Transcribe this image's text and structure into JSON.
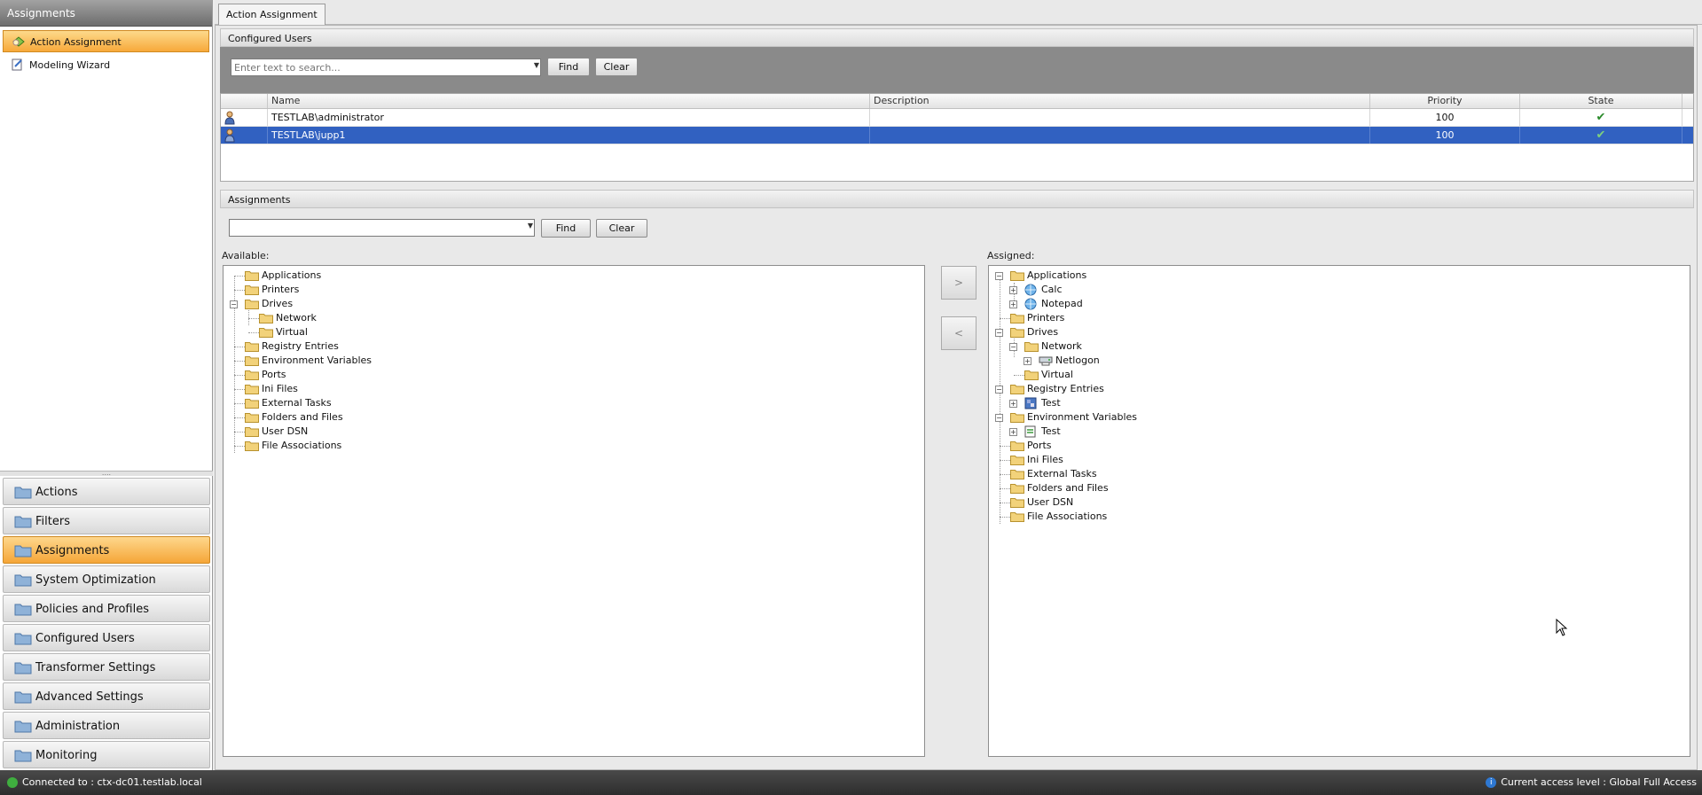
{
  "left_nav": {
    "header": "Assignments",
    "items": [
      {
        "label": "Action Assignment",
        "active": true
      },
      {
        "label": "Modeling Wizard",
        "active": false
      }
    ],
    "splitter_grip": "....",
    "sections": [
      {
        "label": "Actions",
        "active": false
      },
      {
        "label": "Filters",
        "active": false
      },
      {
        "label": "Assignments",
        "active": true
      },
      {
        "label": "System Optimization",
        "active": false
      },
      {
        "label": "Policies and Profiles",
        "active": false
      },
      {
        "label": "Configured Users",
        "active": false
      },
      {
        "label": "Transformer Settings",
        "active": false
      },
      {
        "label": "Advanced Settings",
        "active": false
      },
      {
        "label": "Administration",
        "active": false
      },
      {
        "label": "Monitoring",
        "active": false
      }
    ]
  },
  "tab": {
    "label": "Action Assignment"
  },
  "configured_users": {
    "title": "Configured Users",
    "search_placeholder": "Enter text to search...",
    "find_label": "Find",
    "clear_label": "Clear",
    "columns": [
      "",
      "Name",
      "Description",
      "Priority",
      "State"
    ],
    "rows": [
      {
        "name": "TESTLAB\\administrator",
        "description": "",
        "priority": "100",
        "state": "✔",
        "selected": false
      },
      {
        "name": "TESTLAB\\jupp1",
        "description": "",
        "priority": "100",
        "state": "✔",
        "selected": true
      }
    ]
  },
  "assignments": {
    "title": "Assignments",
    "search_value": "",
    "find_label": "Find",
    "clear_label": "Clear",
    "available_label": "Available:",
    "assigned_label": "Assigned:",
    "add_label": ">",
    "remove_label": "<",
    "available_tree": [
      {
        "label": "Applications"
      },
      {
        "label": "Printers"
      },
      {
        "label": "Drives",
        "expanded": true
      },
      {
        "label": "Network"
      },
      {
        "label": "Virtual"
      },
      {
        "label": "Registry Entries"
      },
      {
        "label": "Environment Variables"
      },
      {
        "label": "Ports"
      },
      {
        "label": "Ini Files"
      },
      {
        "label": "External Tasks"
      },
      {
        "label": "Folders and Files"
      },
      {
        "label": "User DSN"
      },
      {
        "label": "File Associations"
      }
    ],
    "assigned_tree": [
      {
        "label": "Applications"
      },
      {
        "label": "Calc"
      },
      {
        "label": "Notepad"
      },
      {
        "label": "Printers"
      },
      {
        "label": "Drives"
      },
      {
        "label": "Network"
      },
      {
        "label": "Netlogon"
      },
      {
        "label": "Virtual"
      },
      {
        "label": "Registry Entries"
      },
      {
        "label": "Test"
      },
      {
        "label": "Environment Variables"
      },
      {
        "label": "Test"
      },
      {
        "label": "Ports"
      },
      {
        "label": "Ini Files"
      },
      {
        "label": "External Tasks"
      },
      {
        "label": "Folders and Files"
      },
      {
        "label": "User DSN"
      },
      {
        "label": "File Associations"
      }
    ]
  },
  "status": {
    "connection": "Connected to : ctx-dc01.testlab.local",
    "access": "Current access level  : Global Full Access"
  },
  "colors": {
    "accent_orange": "#f7a93a",
    "selection_blue": "#3161c1",
    "ok_green": "#2a8a2a",
    "folder_yellow": "#f2d27a"
  },
  "icons": {
    "folder": "folder-icon",
    "user": "user-icon",
    "check": "checkmark-icon",
    "app": "globe-app-icon",
    "network_drive": "network-drive-icon",
    "registry": "registry-icon",
    "env": "env-variable-icon"
  }
}
